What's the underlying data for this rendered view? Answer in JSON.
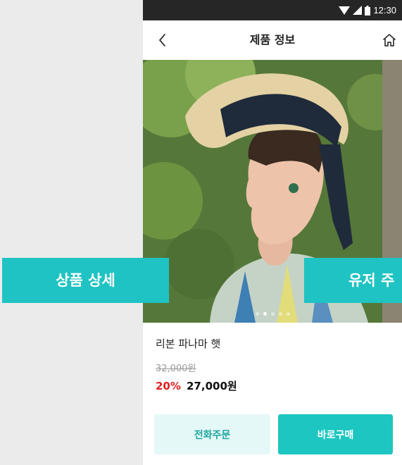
{
  "status_bar": {
    "time": "12:30"
  },
  "app_bar": {
    "title": "제품 정보",
    "back_icon": "chevron-left-icon",
    "home_icon": "home-icon"
  },
  "carousel": {
    "active_index": 1,
    "slide_count": 5
  },
  "product": {
    "name": "리본 파나마 햇",
    "original_price": "32,000원",
    "discount": "20%",
    "price": "27,000원"
  },
  "actions": {
    "phone_order": "전화주문",
    "buy_now": "바로구매"
  },
  "labels": {
    "left": "상품 상세",
    "right": "유저 주"
  },
  "colors": {
    "accent": "#1dc6c1",
    "discount": "#e02020",
    "status_bar": "#262626"
  }
}
